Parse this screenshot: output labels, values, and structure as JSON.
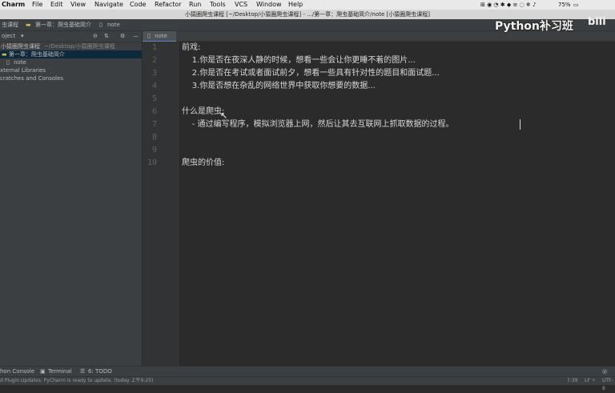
{
  "menubar": {
    "app": "Charm",
    "items": [
      "File",
      "Edit",
      "View",
      "Navigate",
      "Code",
      "Refactor",
      "Run",
      "Tools",
      "VCS",
      "Window",
      "Help"
    ],
    "battery": "75%"
  },
  "window": {
    "title": "小猿圈爬虫课程 [~/Desktop/小猿圈爬虫课程] - .../第一章：爬虫基础简介/note [小猿圈爬虫课程]"
  },
  "breadcrumb": [
    "虫课程",
    "第一章：爬虫基础简介",
    "note"
  ],
  "project": {
    "header": "oject",
    "tree": [
      {
        "label": "小猿圈爬虫课程",
        "suffix": "~/Desktop/小猿圈爬虫课程"
      },
      {
        "label": "第一章：爬虫基础简介"
      },
      {
        "label": "note"
      },
      {
        "label": "xternal Libraries"
      },
      {
        "label": "cratches and Consoles"
      }
    ]
  },
  "tabs": [
    {
      "label": "note"
    }
  ],
  "editor": {
    "line_numbers": [
      "1",
      "2",
      "3",
      "4",
      "5",
      "6",
      "7",
      "8",
      "9",
      "10"
    ],
    "lines": [
      "前戏:",
      "    1.你是否在夜深人静的时候，想看一些会让你更睡不着的图片...",
      "    2.你是否在考试或者面试前夕，想看一些具有针对性的题目和面试题...",
      "    3.你是否想在杂乱的网络世界中获取你想要的数据...",
      "",
      "什么是爬虫:",
      "    - 通过编写程序，模拟浏览器上网，然后让其去互联网上抓取数据的过程。",
      "",
      "",
      "爬虫的价值:"
    ]
  },
  "bottom_tools": [
    "hon Console",
    "Terminal",
    "6: TODO"
  ],
  "status": {
    "message": "d Plugin Updates: PyCharm is ready to update. (today 上午9:25)",
    "position": "7:39",
    "line_sep": "LF ÷",
    "encoding": "UTF-8"
  },
  "watermark": {
    "text": "Python补习班",
    "logo": "bili"
  }
}
